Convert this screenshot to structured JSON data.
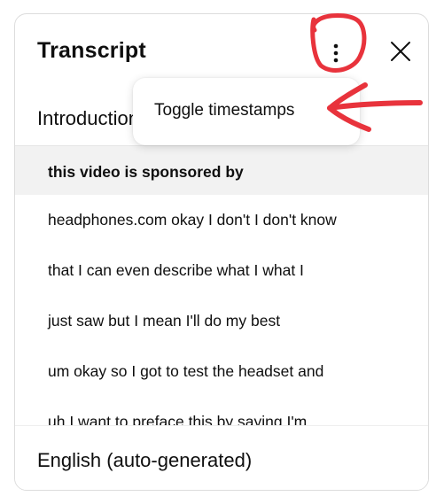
{
  "panel": {
    "title": "Transcript",
    "more_icon": "vertical-dots-icon",
    "close_icon": "close-icon"
  },
  "chapter": {
    "title": "Introduction"
  },
  "segments": [
    {
      "text": "this video is sponsored by",
      "active": true
    },
    {
      "text": "headphones.com okay I don't I don't know",
      "active": false
    },
    {
      "text": "that I can even describe what I what I",
      "active": false
    },
    {
      "text": "just saw but I mean I'll do my best",
      "active": false
    },
    {
      "text": "um okay so I got to test the headset and",
      "active": false
    },
    {
      "text": "uh I want to preface this by saying I'm",
      "active": false
    }
  ],
  "menu": {
    "items": [
      {
        "label": "Toggle timestamps"
      }
    ]
  },
  "footer": {
    "language": "English (auto-generated)"
  },
  "annotations": {
    "color": "#e8333c"
  }
}
